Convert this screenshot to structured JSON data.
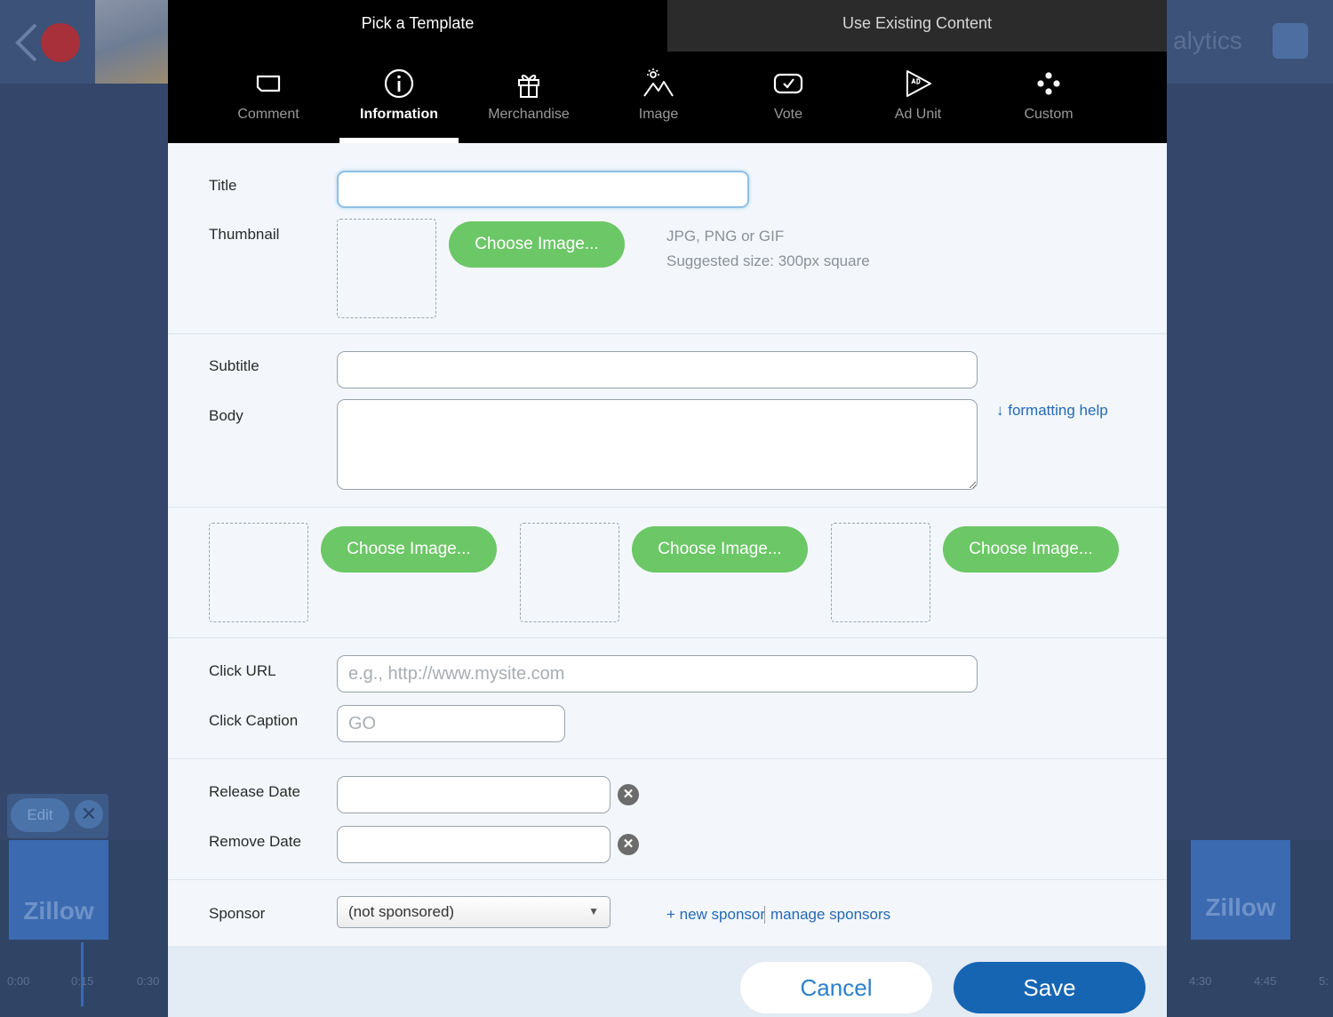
{
  "background": {
    "analytics_partial": "alytics",
    "edit_label": "Edit",
    "zillow_label": "Zillow",
    "timeline_ticks_left": [
      "0:00",
      "0:15",
      "0:30"
    ],
    "timeline_ticks_right": [
      "4:30",
      "4:45",
      "5:"
    ]
  },
  "tabs": {
    "pick_template": "Pick a Template",
    "use_existing": "Use Existing Content"
  },
  "types": [
    {
      "label": "Comment",
      "icon": "comment-icon"
    },
    {
      "label": "Information",
      "icon": "info-icon",
      "active": true
    },
    {
      "label": "Merchandise",
      "icon": "gift-icon"
    },
    {
      "label": "Image",
      "icon": "image-icon"
    },
    {
      "label": "Vote",
      "icon": "vote-icon"
    },
    {
      "label": "Ad Unit",
      "icon": "ad-unit-icon"
    },
    {
      "label": "Custom",
      "icon": "custom-icon"
    }
  ],
  "form": {
    "title_label": "Title",
    "title_value": "",
    "thumbnail_label": "Thumbnail",
    "choose_image": "Choose Image...",
    "hint_formats": "JPG, PNG or GIF",
    "hint_size": "Suggested size: 300px square",
    "subtitle_label": "Subtitle",
    "body_label": "Body",
    "formatting_help": "↓ formatting help",
    "click_url_label": "Click URL",
    "click_url_placeholder": "e.g., http://www.mysite.com",
    "click_caption_label": "Click Caption",
    "click_caption_placeholder": "GO",
    "release_date_label": "Release Date",
    "remove_date_label": "Remove Date",
    "sponsor_label": "Sponsor",
    "sponsor_value": "(not sponsored)",
    "new_sponsor": "+ new sponsor",
    "manage_sponsors": "manage sponsors"
  },
  "footer": {
    "cancel": "Cancel",
    "save": "Save"
  },
  "colors": {
    "accent_green": "#6cc766",
    "save_blue": "#1565b3",
    "link_blue": "#2469b8"
  }
}
